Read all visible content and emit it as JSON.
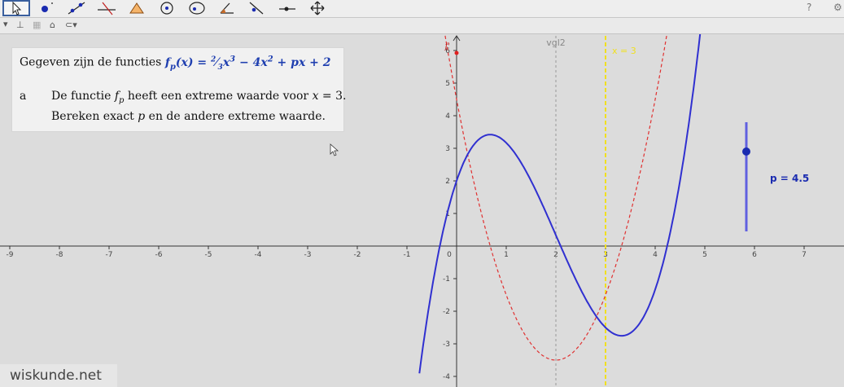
{
  "toolbar": {
    "tools": [
      {
        "icon": "move-arrow-icon",
        "selected": true
      },
      {
        "icon": "new-point-icon"
      },
      {
        "icon": "line-through-two-points-icon"
      },
      {
        "icon": "perpendicular-line-icon"
      },
      {
        "icon": "polygon-icon"
      },
      {
        "icon": "circle-with-center-icon"
      },
      {
        "icon": "ellipse-icon"
      },
      {
        "icon": "angle-icon"
      },
      {
        "icon": "reflect-about-line-icon"
      },
      {
        "icon": "slider-icon"
      },
      {
        "icon": "move-graphics-view-icon"
      }
    ],
    "help_icon": "help-icon",
    "settings_icon": "gear-icon"
  },
  "subbar": {
    "icons": [
      "dropdown-arrow-icon",
      "axes-toggle-icon",
      "grid-toggle-icon",
      "home-icon",
      "point-capture-icon"
    ]
  },
  "task": {
    "intro": "Gegeven zijn de functies",
    "formula": "f_p(x) = (2/3)x^3 − 4x^2 + px + 2",
    "item_letter": "a",
    "item_line1": "De functie f_p heeft een extreme waarde voor x = 3.",
    "item_line2": "Bereken exact p en de andere extreme waarde."
  },
  "graph": {
    "x_ticks": [
      "-9",
      "-8",
      "-7",
      "-6",
      "-5",
      "-4",
      "-3",
      "-2",
      "-1",
      "0",
      "1",
      "2",
      "3",
      "4",
      "5",
      "6",
      "7"
    ],
    "y_ticks": [
      "-4",
      "-3",
      "-2",
      "-1",
      "1",
      "2",
      "3",
      "4",
      "5",
      "6"
    ],
    "vgl2_label": "vgl2",
    "x3_label": "x = 3",
    "derivative_label": "f'",
    "slider_value": 4.5,
    "slider_label": "p = 4.5",
    "colors": {
      "curve": "#3030d0",
      "derivative": "#e03030",
      "vline": "#f0e020",
      "axis": "#333333"
    }
  },
  "watermark": "wiskunde.net"
}
